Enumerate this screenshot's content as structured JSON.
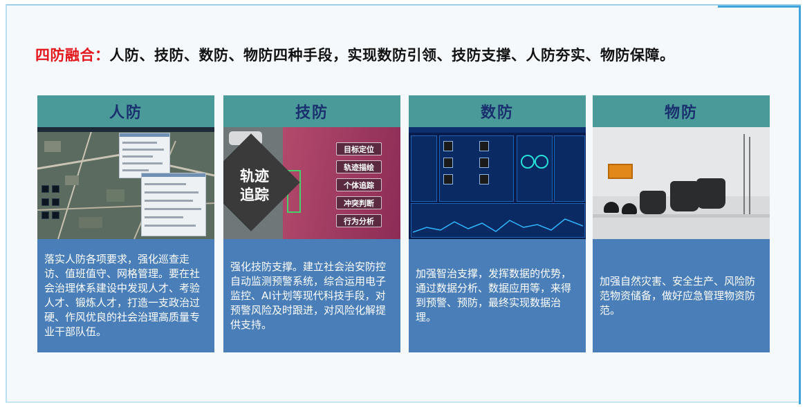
{
  "headline": {
    "label": "四防融合：",
    "text": "人防、技防、数防、物防四种手段，实现数防引领、技防支撑、人防夯实、物防保障。"
  },
  "cards": [
    {
      "title": "人防",
      "body": "落实人防各项要求，强化巡查走访、值班值守、网格管理。要在社会治理体系建设中发现人才、考验人才、锻炼人才，打造一支政治过硬、作风优良的社会治理高质量专业干部队伍。"
    },
    {
      "title": "技防",
      "body": "强化技防支撑。建立社会治安防控自动监测预警系统，综合运用电子监控、AI计划等现代科技手段，对预警风险及时跟进，对风险化解提供支持。",
      "image": {
        "overlay_text": "轨迹追踪",
        "tags": [
          "目标定位",
          "轨迹描绘",
          "个体追踪",
          "冲突判断",
          "行为分析"
        ]
      }
    },
    {
      "title": "数防",
      "body": "加强智治支撑，发挥数据的优势，通过数据分析、数据应用等，来得到预警、预防，最终实现数据治理。"
    },
    {
      "title": "物防",
      "body": "加强自然灾害、安全生产、风险防范物资储备，做好应急管理物资防范。"
    }
  ],
  "colors": {
    "accent_red": "#e3161c",
    "title_bar": "#4a9a99",
    "title_text": "#1a2f6e",
    "body_bg": "#4a7eb8"
  }
}
